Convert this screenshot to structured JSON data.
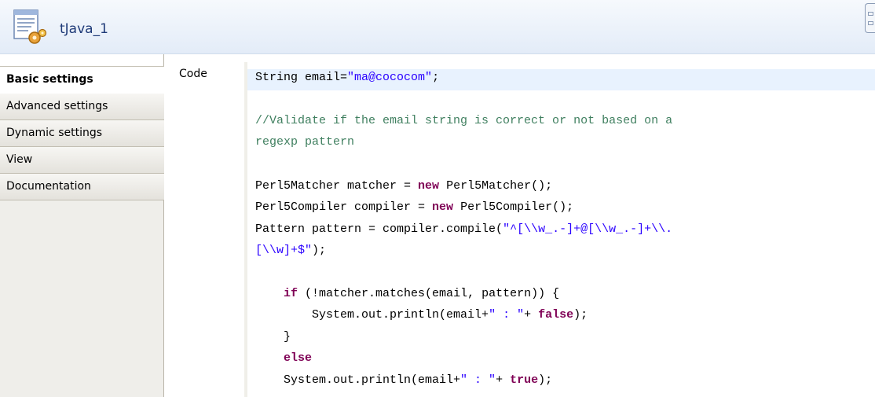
{
  "header": {
    "title": "tJava_1",
    "icon": "java-component-icon",
    "corner_icon": "window-layout-icon"
  },
  "sidebar": {
    "tabs": [
      {
        "label": "Basic settings",
        "active": true
      },
      {
        "label": "Advanced settings",
        "active": false
      },
      {
        "label": "Dynamic settings",
        "active": false
      },
      {
        "label": "View",
        "active": false
      },
      {
        "label": "Documentation",
        "active": false
      }
    ]
  },
  "main": {
    "code_label": "Code",
    "code_lines": [
      {
        "segments": [
          [
            "plain",
            "String email="
          ],
          [
            "str",
            "\"ma@cococom\""
          ],
          [
            "plain",
            ";"
          ]
        ]
      },
      {
        "segments": []
      },
      {
        "segments": [
          [
            "cmt",
            "//Validate if the email string is correct or not based on a"
          ]
        ]
      },
      {
        "segments": [
          [
            "cmt",
            "regexp pattern"
          ]
        ]
      },
      {
        "segments": []
      },
      {
        "segments": [
          [
            "plain",
            "Perl5Matcher matcher = "
          ],
          [
            "kw",
            "new"
          ],
          [
            "plain",
            " Perl5Matcher();"
          ]
        ]
      },
      {
        "segments": [
          [
            "plain",
            "Perl5Compiler compiler = "
          ],
          [
            "kw",
            "new"
          ],
          [
            "plain",
            " Perl5Compiler();"
          ]
        ]
      },
      {
        "segments": [
          [
            "plain",
            "Pattern pattern = compiler.compile("
          ],
          [
            "str",
            "\"^[\\\\w_.-]+@[\\\\w_.-]+\\\\."
          ]
        ]
      },
      {
        "segments": [
          [
            "str",
            "[\\\\w]+$\""
          ],
          [
            "plain",
            ");"
          ]
        ]
      },
      {
        "segments": []
      },
      {
        "segments": [
          [
            "plain",
            "    "
          ],
          [
            "kw",
            "if"
          ],
          [
            "plain",
            " (!matcher.matches(email, pattern)) {"
          ]
        ]
      },
      {
        "segments": [
          [
            "plain",
            "        System.out.println(email+"
          ],
          [
            "str",
            "\" : \""
          ],
          [
            "plain",
            "+ "
          ],
          [
            "kw",
            "false"
          ],
          [
            "plain",
            ");"
          ]
        ]
      },
      {
        "segments": [
          [
            "plain",
            "    }"
          ]
        ]
      },
      {
        "segments": [
          [
            "plain",
            "    "
          ],
          [
            "kw",
            "else"
          ]
        ]
      },
      {
        "segments": [
          [
            "plain",
            "    System.out.println(email+"
          ],
          [
            "str",
            "\" : \""
          ],
          [
            "plain",
            "+ "
          ],
          [
            "kw",
            "true"
          ],
          [
            "plain",
            ");"
          ]
        ]
      }
    ]
  },
  "colors": {
    "string": "#2a00ff",
    "comment": "#3f7f5f",
    "keyword": "#7f0055",
    "current_line": "#e8f2fe",
    "header_title": "#1e3a78"
  }
}
